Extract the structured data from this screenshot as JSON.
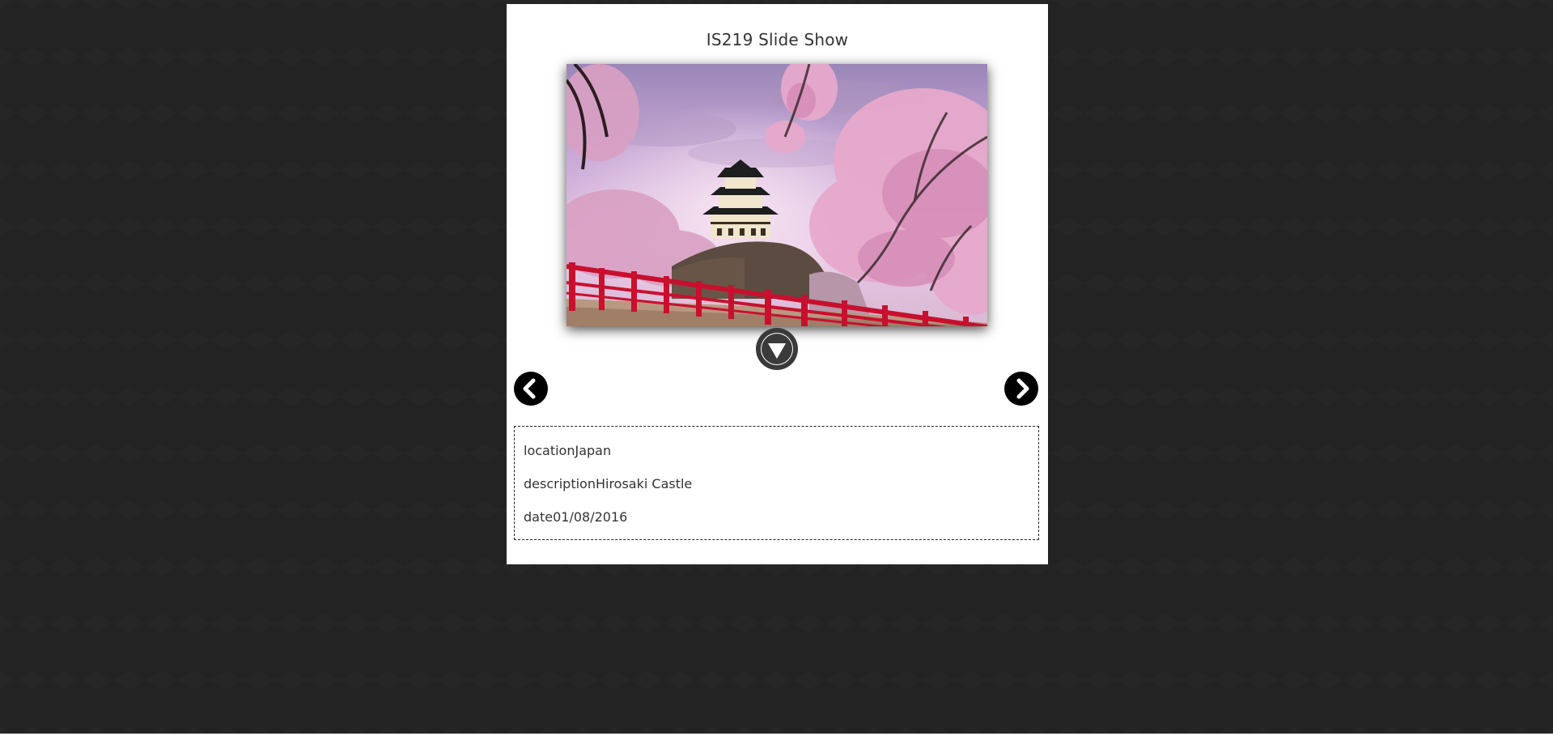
{
  "slideshow": {
    "title": "IS219 Slide Show",
    "photo_alt": "Hirosaki Castle",
    "info": {
      "location_label": "location",
      "location_value": "Japan",
      "description_label": "description",
      "description_value": "Hirosaki Castle",
      "date_label": "date",
      "date_value": "01/08/2016"
    }
  },
  "controls": {
    "toggle_icon": "chevron-down-circle-icon",
    "prev_icon": "chevron-left-icon",
    "next_icon": "chevron-right-icon"
  },
  "colors": {
    "background": "#232323",
    "panel": "#ffffff",
    "button": "#000000",
    "railing": "#c8102e"
  }
}
